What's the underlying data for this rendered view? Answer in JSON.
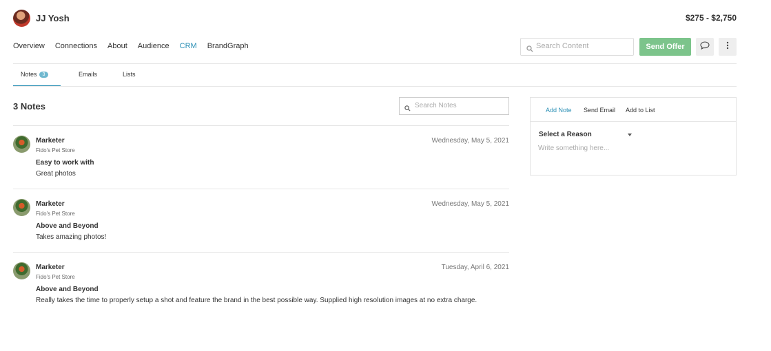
{
  "profile": {
    "name": "JJ Yosh",
    "price_range": "$275 - $2,750"
  },
  "nav": {
    "items": [
      {
        "label": "Overview",
        "active": false
      },
      {
        "label": "Connections",
        "active": false
      },
      {
        "label": "About",
        "active": false
      },
      {
        "label": "Audience",
        "active": false
      },
      {
        "label": "CRM",
        "active": true
      },
      {
        "label": "BrandGraph",
        "active": false
      }
    ],
    "search_placeholder": "Search Content",
    "send_offer_label": "Send Offer"
  },
  "subtabs": {
    "notes": {
      "label": "Notes",
      "count": "3"
    },
    "emails": {
      "label": "Emails"
    },
    "lists": {
      "label": "Lists"
    }
  },
  "notes_section": {
    "title": "3 Notes",
    "search_placeholder": "Search Notes",
    "notes": [
      {
        "author": "Marketer",
        "org": "Fido's Pet Store",
        "date": "Wednesday, May 5, 2021",
        "subject": "Easy to work with",
        "body": "Great photos"
      },
      {
        "author": "Marketer",
        "org": "Fido's Pet Store",
        "date": "Wednesday, May 5, 2021",
        "subject": "Above and Beyond",
        "body": "Takes amazing photos!"
      },
      {
        "author": "Marketer",
        "org": "Fido's Pet Store",
        "date": "Tuesday, April 6, 2021",
        "subject": "Above and Beyond",
        "body": "Really takes the time to properly setup a shot and feature the brand in the best possible way. Supplied high resolution images at no extra charge."
      }
    ]
  },
  "side_panel": {
    "tabs": [
      {
        "label": "Add Note",
        "active": true
      },
      {
        "label": "Send Email",
        "active": false
      },
      {
        "label": "Add to List",
        "active": false
      }
    ],
    "reason_label": "Select a Reason",
    "textarea_placeholder": "Write something here..."
  },
  "colors": {
    "accent": "#2a8fb5",
    "send_offer": "#7cc48b",
    "badge": "#6fb8cf"
  }
}
